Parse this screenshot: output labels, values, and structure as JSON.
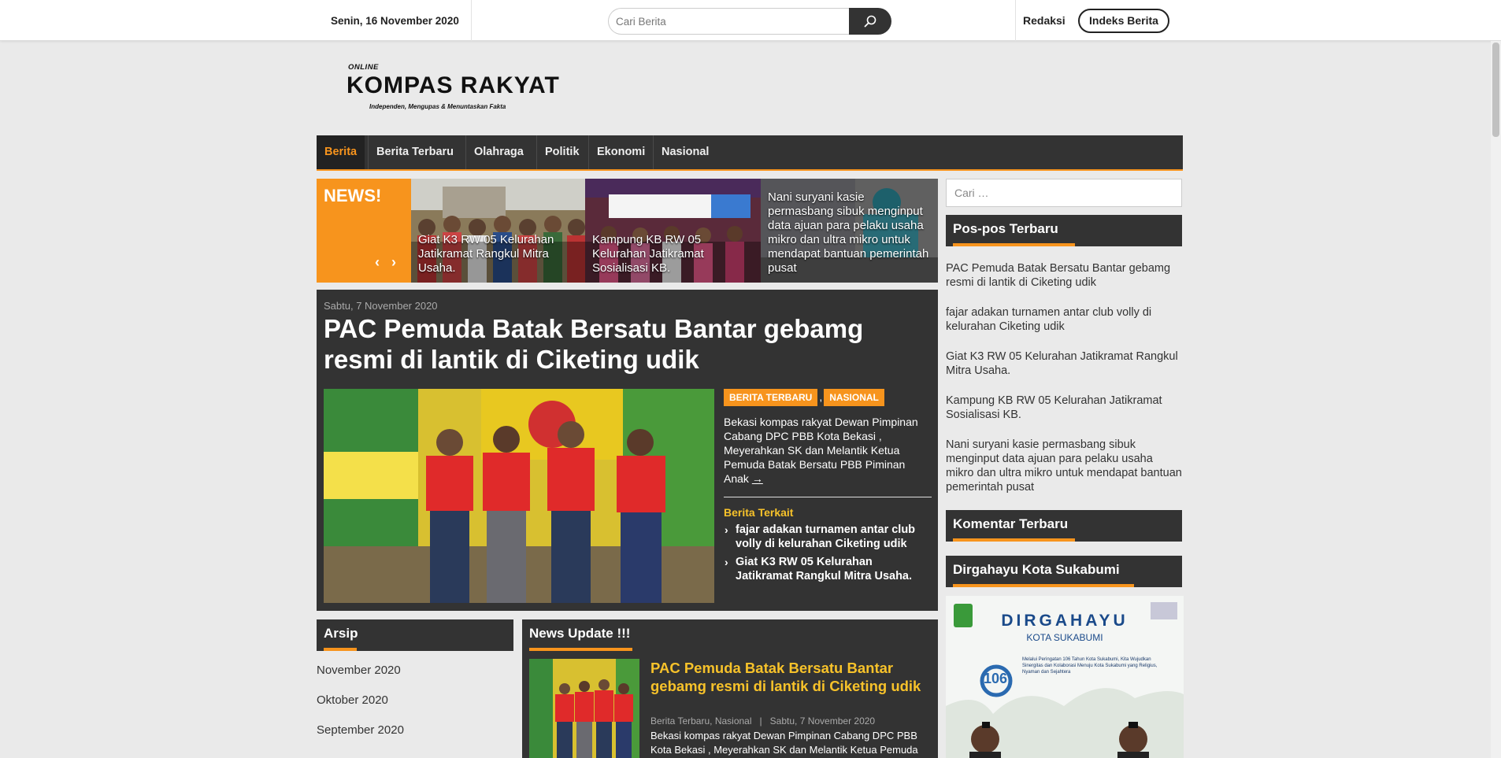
{
  "topbar": {
    "date": "Senin, 16 November 2020",
    "search_placeholder": "Cari Berita",
    "search_icon": "search-icon",
    "redaksi": "Redaksi",
    "indeks": "Indeks Berita"
  },
  "logo": {
    "online": "ONLINE",
    "name": "KOMPAS RAKYAT",
    "tagline": "Independen, Mengupas & Menuntaskan Fakta"
  },
  "nav": {
    "items": [
      "Berita",
      "Berita Terbaru",
      "Olahraga",
      "Politik",
      "Ekonomi",
      "Nasional"
    ],
    "active": "Berita"
  },
  "ticker": {
    "label": "NEWS!",
    "prev": "‹",
    "next": "›",
    "items": [
      "Giat K3 RW 05 Kelurahan Jatikramat Rangkul Mitra Usaha.",
      "Kampung KB RW 05 Kelurahan Jatikramat Sosialisasi KB.",
      "Nani suryani kasie permasbang sibuk menginput data ajuan para pelaku usaha mikro dan ultra mikro untuk mendapat bantuan pemerintah pusat"
    ]
  },
  "featured": {
    "date": "Sabtu, 7 November 2020",
    "title": "PAC Pemuda Batak Bersatu Bantar gebamg resmi di lantik di Ciketing udik",
    "categories": [
      "BERITA TERBARU",
      "NASIONAL"
    ],
    "separator": ",",
    "excerpt": "Bekasi kompas rakyat Dewan Pimpinan Cabang DPC PBB Kota Bekasi , Meyerahkan SK dan Melantik Ketua Pemuda Batak Bersatu PBB Piminan Anak",
    "read_more": "→",
    "related_title": "Berita Terkait",
    "related": [
      "fajar adakan turnamen antar club volly di kelurahan Ciketing udik",
      "Giat K3 RW 05 Kelurahan Jatikramat Rangkul Mitra Usaha."
    ]
  },
  "sidebar": {
    "search_placeholder": "Cari …",
    "recent_title": "Pos-pos Terbaru",
    "recent": [
      "PAC Pemuda Batak Bersatu Bantar gebamg resmi di lantik di Ciketing udik",
      "fajar adakan turnamen antar club volly di kelurahan Ciketing udik",
      "Giat K3 RW 05 Kelurahan Jatikramat Rangkul Mitra Usaha.",
      "Kampung KB RW 05 Kelurahan Jatikramat Sosialisasi KB.",
      "Nani suryani kasie permasbang sibuk menginput data ajuan para pelaku usaha mikro dan ultra mikro untuk mendapat bantuan pemerintah pusat"
    ],
    "comments_title": "Komentar Terbaru",
    "ad_title": "Dirgahayu Kota Sukabumi",
    "ad": {
      "heading": "DIRGAHAYU",
      "subheading": "KOTA SUKABUMI",
      "number": "106",
      "text": "Melalui Peringatan 106 Tahun Kota Sukabumi, Kita Wujudkan Sinergitas dan Kolaborasi Menuju Kota Sukabumi yang Religius, Nyaman dan Sejahtera"
    }
  },
  "arsip": {
    "title": "Arsip",
    "items": [
      "November 2020",
      "Oktober 2020",
      "September 2020"
    ]
  },
  "news_update": {
    "title": "News Update !!!",
    "item": {
      "title": "PAC Pemuda Batak Bersatu Bantar gebamg resmi di lantik di Ciketing udik",
      "categories": "Berita Terbaru, Nasional",
      "meta_sep": "|",
      "date": "Sabtu, 7 November 2020",
      "excerpt": "Bekasi kompas rakyat Dewan Pimpinan Cabang DPC PBB Kota Bekasi , Meyerahkan SK dan Melantik Ketua Pemuda"
    }
  },
  "colors": {
    "accent": "#f7941d",
    "dark": "#333333",
    "highlight": "#f7c22a"
  }
}
